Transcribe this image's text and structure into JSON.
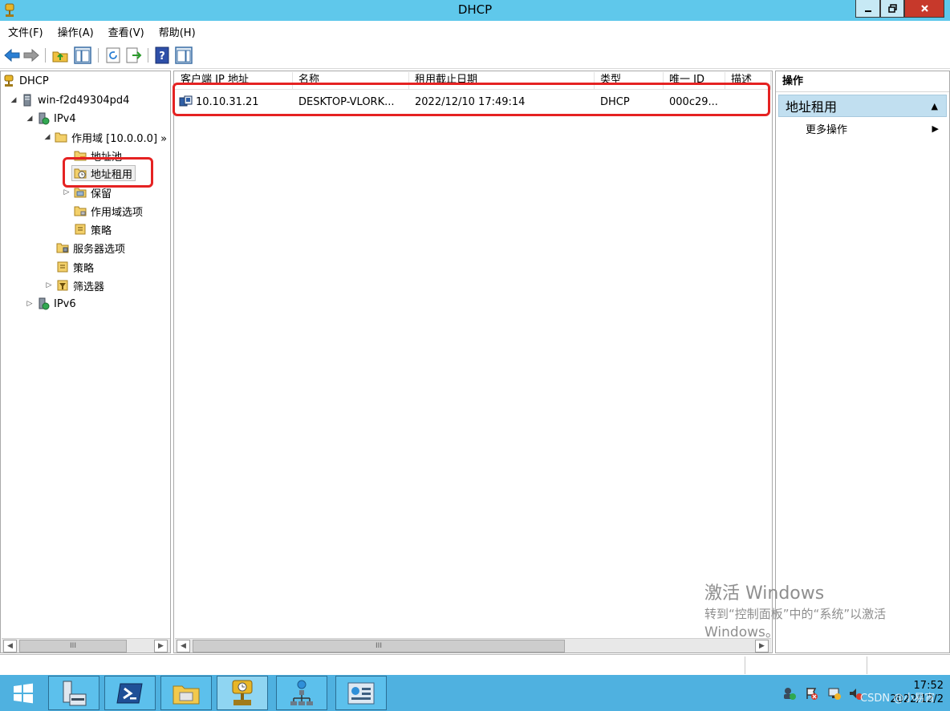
{
  "window": {
    "title": "DHCP"
  },
  "menu": [
    "文件(F)",
    "操作(A)",
    "查看(V)",
    "帮助(H)"
  ],
  "tree": {
    "root": "DHCP",
    "server": "win-f2d49304pd4",
    "ipv4": "IPv4",
    "scope": "作用域 [10.0.0.0] »",
    "address_pool": "地址池",
    "address_leases": "地址租用",
    "reservations": "保留",
    "scope_options": "作用域选项",
    "scope_policies": "策略",
    "server_options": "服务器选项",
    "policies": "策略",
    "filters": "筛选器",
    "ipv6": "IPv6"
  },
  "list": {
    "columns": [
      "客户端 IP 地址",
      "名称",
      "租用截止日期",
      "类型",
      "唯一 ID",
      "描述"
    ],
    "rows": [
      {
        "ip": "10.10.31.21",
        "name": "DESKTOP-VLORK...",
        "expiry": "2022/12/10 17:49:14",
        "type": "DHCP",
        "uid": "000c29...",
        "desc": ""
      }
    ]
  },
  "actions": {
    "header": "操作",
    "section": "地址租用",
    "more": "更多操作"
  },
  "scrollbar": {
    "grip": "III"
  },
  "activation": {
    "line1": "激活 Windows",
    "line2": "转到“控制面板”中的“系统”以激活",
    "line3": "Windows。"
  },
  "clock": {
    "time": "17:52",
    "date": "2022/12/2"
  },
  "watermark": "CSDN @小易宵",
  "colors": {
    "titlebar": "#5fc8eb",
    "taskbar": "#4fb1e0",
    "annotation": "#e52222",
    "selection": "#c1dff0"
  }
}
